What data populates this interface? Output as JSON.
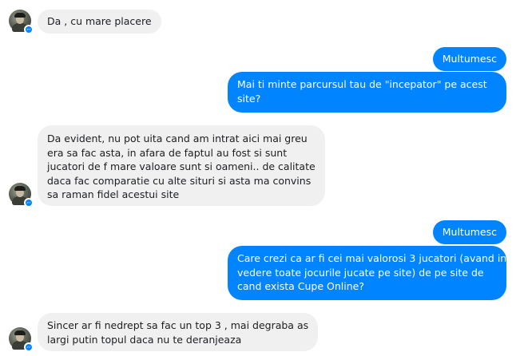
{
  "conversation": {
    "messages": [
      {
        "sender": "other",
        "lines": [
          "Da , cu mare placere"
        ]
      },
      {
        "sender": "me",
        "lines": [
          "Multumesc"
        ]
      },
      {
        "sender": "me",
        "lines": [
          "Mai ti minte parcursul tau de \"incepator\" pe acest",
          "site?"
        ]
      },
      {
        "sender": "other",
        "lines": [
          "Da evident, nu pot uita cand am intrat aici mai greu",
          "era sa fac asta, in afara de faptul au fost si sunt",
          "jucatori de f mare valoare sunt si oameni.. de calitate",
          "daca fac comparatie cu alte situri si asta ma convins",
          "sa raman fidel acestui site"
        ]
      },
      {
        "sender": "me",
        "lines": [
          "Multumesc"
        ]
      },
      {
        "sender": "me",
        "lines": [
          "Care crezi ca ar fi cei mai valorosi 3 jucatori (avand in",
          "vedere toate jocurile jucate pe site) de pe site de",
          "cand exista Cupe Online?"
        ]
      },
      {
        "sender": "other",
        "lines": [
          "Sincer ar fi nedrept sa fac un top 3 , mai degraba as",
          "largi putin topul daca nu te deranjeaza"
        ]
      }
    ]
  },
  "colors": {
    "outgoing_bubble": "#0084ff",
    "incoming_bubble": "#f0f0f0",
    "messenger_badge": "#0084ff"
  },
  "icons": {
    "avatar": "user-avatar",
    "badge": "messenger-badge-icon"
  }
}
